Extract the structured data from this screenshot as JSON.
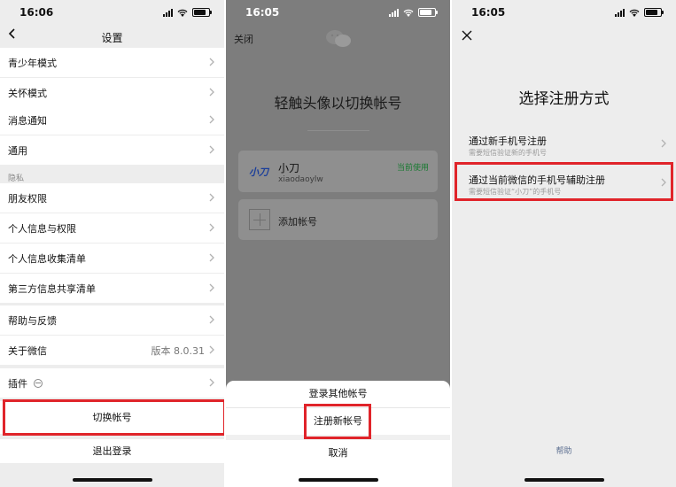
{
  "panel1": {
    "time": "16:06",
    "title": "设置",
    "group_a": [
      "青少年模式",
      "关怀模式"
    ],
    "group_b": [
      "消息通知",
      "通用"
    ],
    "privacy_label": "隐私",
    "group_c": [
      "朋友权限",
      "个人信息与权限",
      "个人信息收集清单",
      "第三方信息共享清单"
    ],
    "help": "帮助与反馈",
    "about": "关于微信",
    "version": "版本 8.0.31",
    "plugins": "插件",
    "switch_account": "切换帐号",
    "logout": "退出登录"
  },
  "panel2": {
    "time": "16:05",
    "close": "关闭",
    "heading": "轻触头像以切换帐号",
    "account": {
      "badge": "小刀",
      "name": "小刀",
      "id": "xiaodaoylw",
      "status": "当前使用"
    },
    "add_account": "添加帐号",
    "sheet": {
      "login_other": "登录其他帐号",
      "register_new": "注册新帐号",
      "cancel": "取消"
    }
  },
  "panel3": {
    "time": "16:05",
    "heading": "选择注册方式",
    "options": [
      {
        "title": "通过新手机号注册",
        "subtitle": "需要短信验证新的手机号"
      },
      {
        "title": "通过当前微信的手机号辅助注册",
        "subtitle": "需要短信验证“小刀”的手机号"
      }
    ],
    "help": "帮助"
  },
  "colors": {
    "highlight": "#e0242a",
    "in_use": "#1a7a32",
    "link": "#5a6d8f"
  }
}
